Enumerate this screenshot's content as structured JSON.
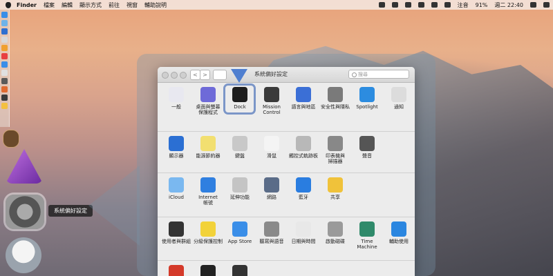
{
  "menubar": {
    "items": [
      "Finder",
      "檔案",
      "編輯",
      "顯示方式",
      "前往",
      "視窗",
      "輔助說明"
    ],
    "input_method": "注音",
    "battery": "91%",
    "clock": "週二 22:40"
  },
  "dock": {
    "tooltip": "系統偏好設定"
  },
  "window": {
    "title": "系統偏好設定",
    "back_label": "<",
    "forward_label": ">",
    "search_placeholder": "搜尋",
    "rows": [
      [
        {
          "label": "一般",
          "color": "#e8e8f0"
        },
        {
          "label": "桌面與螢幕\n保護程式",
          "color": "#6e6ad8"
        },
        {
          "label": "Dock",
          "color": "#1e1e1e"
        },
        {
          "label": "Mission\nControl",
          "color": "#3a3a3a"
        },
        {
          "label": "語言與地區",
          "color": "#3b6fd6"
        },
        {
          "label": "安全性與隱私",
          "color": "#7a7a7a"
        },
        {
          "label": "Spotlight",
          "color": "#2c8ce0"
        },
        {
          "label": "通知",
          "color": "#dcdcdc"
        }
      ],
      [
        {
          "label": "顯示器",
          "color": "#2b6fd3"
        },
        {
          "label": "能源節約器",
          "color": "#f2df70"
        },
        {
          "label": "鍵盤",
          "color": "#c8c8c8"
        },
        {
          "label": "滑鼠",
          "color": "#f4f4f4"
        },
        {
          "label": "觸控式軌跡板",
          "color": "#b8b8b8"
        },
        {
          "label": "印表機與\n掃描器",
          "color": "#888888"
        },
        {
          "label": "聲音",
          "color": "#555555"
        }
      ],
      [
        {
          "label": "iCloud",
          "color": "#7ab8f0"
        },
        {
          "label": "Internet\n帳號",
          "color": "#2f7fe0"
        },
        {
          "label": "延伸功能",
          "color": "#c4c4c4"
        },
        {
          "label": "網路",
          "color": "#5a6c88"
        },
        {
          "label": "藍牙",
          "color": "#2a7de0"
        },
        {
          "label": "共享",
          "color": "#f0c23a"
        }
      ],
      [
        {
          "label": "使用者與群組",
          "color": "#333333"
        },
        {
          "label": "分級保護控制",
          "color": "#f2d23a"
        },
        {
          "label": "App Store",
          "color": "#3a8ee8"
        },
        {
          "label": "聽寫與語音",
          "color": "#8a8a8a"
        },
        {
          "label": "日期與時間",
          "color": "#e8e8e8"
        },
        {
          "label": "啟動磁碟",
          "color": "#9a9a9a"
        },
        {
          "label": "Time Machine",
          "color": "#2f8a6a"
        },
        {
          "label": "輔助使用",
          "color": "#2a86e0"
        }
      ],
      [
        {
          "label": "",
          "color": "#d43a2a"
        },
        {
          "label": "",
          "color": "#222222"
        },
        {
          "label": "",
          "color": "#333333"
        }
      ]
    ]
  }
}
